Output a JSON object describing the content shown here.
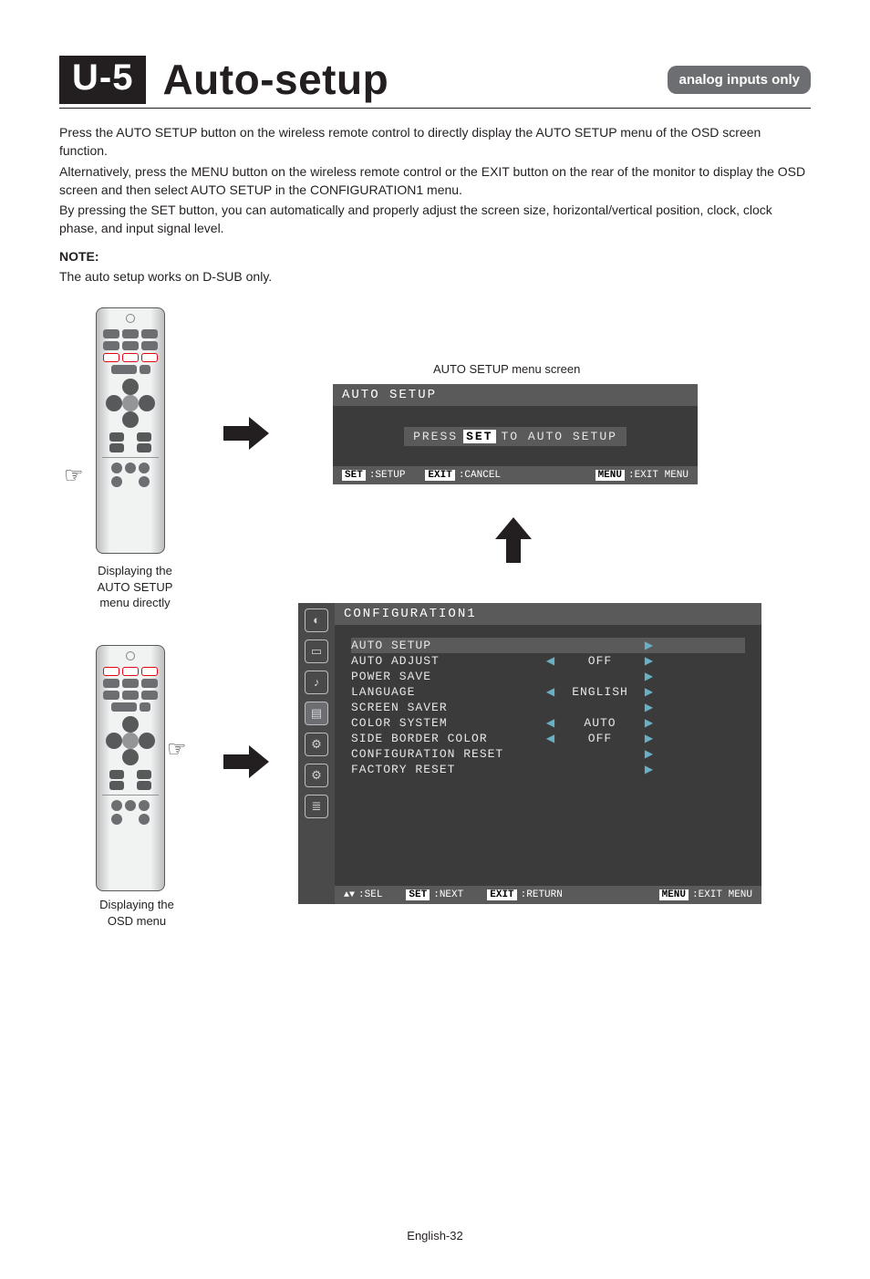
{
  "header": {
    "section_code": "U-5",
    "title": "Auto-setup",
    "pill": "analog inputs only"
  },
  "paragraphs": {
    "p1": "Press the AUTO SETUP button on the wireless remote control to directly display the AUTO SETUP menu of the OSD screen function.",
    "p2": "Alternatively, press the MENU button on the wireless remote control or the EXIT button on the rear of the monitor to display the OSD screen and then select AUTO SETUP in the CONFIGURATION1 menu.",
    "p3": "By pressing the SET button, you can automatically and properly adjust the screen size, horizontal/vertical position, clock, clock phase, and input signal level.",
    "note_label": "NOTE:",
    "note_body": "The auto setup works on D-SUB only."
  },
  "captions": {
    "remote_top": "Displaying the AUTO SETUP menu directly",
    "remote_bottom": "Displaying the OSD menu",
    "auto_menu_title": "AUTO SETUP menu screen"
  },
  "osd_auto": {
    "title": "AUTO SETUP",
    "press_prefix": "PRESS",
    "press_chip": "SET",
    "press_suffix": "TO AUTO SETUP",
    "bar": {
      "set_chip": "SET",
      "set_label": ":SETUP",
      "exit_chip": "EXIT",
      "exit_label": ":CANCEL",
      "menu_chip": "MENU",
      "menu_label": ":EXIT MENU"
    }
  },
  "osd_conf": {
    "title": "CONFIGURATION1",
    "rows": [
      {
        "label": "AUTO SETUP",
        "left": "",
        "value": "",
        "right": "▶",
        "hl": true
      },
      {
        "label": "AUTO ADJUST",
        "left": "◀",
        "value": "OFF",
        "right": "▶"
      },
      {
        "label": "POWER SAVE",
        "left": "",
        "value": "",
        "right": "▶"
      },
      {
        "label": "LANGUAGE",
        "left": "◀",
        "value": "ENGLISH",
        "right": "▶"
      },
      {
        "label": "SCREEN SAVER",
        "left": "",
        "value": "",
        "right": "▶"
      },
      {
        "label": "COLOR SYSTEM",
        "left": "◀",
        "value": "AUTO",
        "right": "▶"
      },
      {
        "label": "SIDE BORDER COLOR",
        "left": "◀",
        "value": "OFF",
        "right": "▶"
      },
      {
        "label": "CONFIGURATION RESET",
        "left": "",
        "value": "",
        "right": "▶"
      },
      {
        "label": "FACTORY RESET",
        "left": "",
        "value": "",
        "right": "▶"
      }
    ],
    "foot": {
      "sel": ":SEL",
      "set_chip": "SET",
      "set_label": ":NEXT",
      "exit_chip": "EXIT",
      "exit_label": ":RETURN",
      "menu_chip": "MENU",
      "menu_label": ":EXIT MENU"
    }
  },
  "footer": "English-32"
}
